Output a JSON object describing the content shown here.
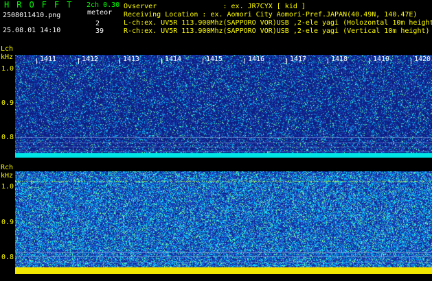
{
  "header": {
    "title": "HROFFT",
    "mode": "2ch 0.30",
    "meteor_label": "meteor",
    "filename": "2508011410.png",
    "datetime": "25.08.01 14:10",
    "count_l": "2",
    "count_r": "39",
    "observer": "Ovserver                : ex. JR7CYX [ kid ]",
    "location": "Receiving Location : ex. Aomori City Aomori-Pref.JAPAN(40.49N, 140.47E)",
    "lch_info": "L-ch:ex. UV5R 113.900Mhz(SAPPORO VOR)USB ,2-ele yagi (Holozontal 10m height)",
    "rch_info": "R-ch:ex. UV5R 113.900Mhz(SAPPORO VOR)USB ,2-ele yagi (Vertical 10m height)"
  },
  "lch": {
    "label": "Lch",
    "unit": "kHz",
    "ticks": [
      "1.0",
      "0.9",
      "0.8"
    ]
  },
  "rch": {
    "label": "Rch",
    "unit": "kHz",
    "ticks": [
      "1.0",
      "0.9",
      "0.8"
    ]
  },
  "times": [
    "1411",
    "1412",
    "1413",
    "1414",
    "1415",
    "1416",
    "1417",
    "1418",
    "1419",
    "1420"
  ],
  "colors": {
    "background": "#000000",
    "accent_green": "#00ff00",
    "label_yellow": "#ffff00",
    "noise_blue": "#1f3aa8",
    "signal_cyan": "#00ffff",
    "band_yellow": "#ffff00"
  }
}
